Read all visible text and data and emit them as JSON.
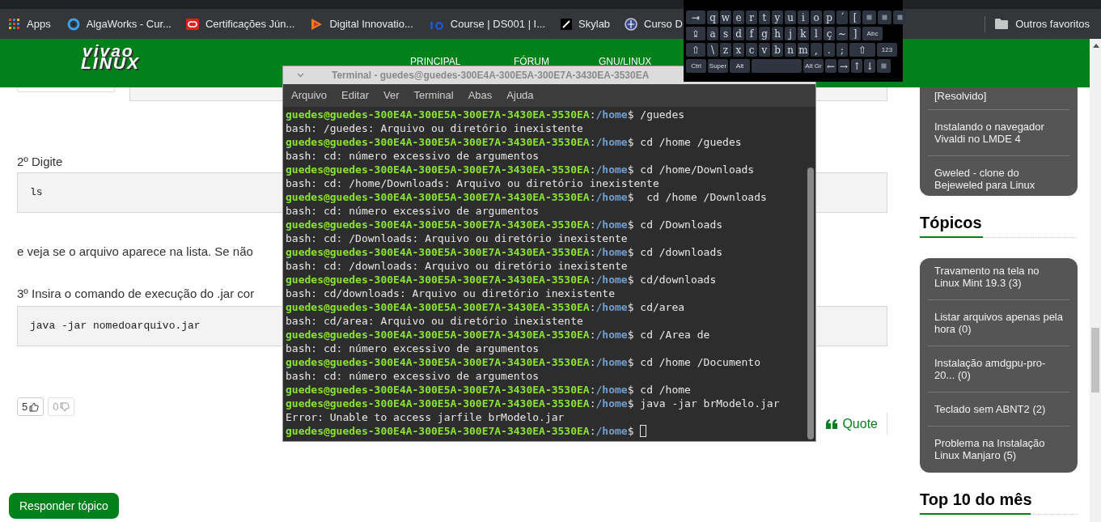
{
  "bookmarks_bar": {
    "items": [
      {
        "label": "Apps"
      },
      {
        "label": "AlgaWorks - Cur..."
      },
      {
        "label": "Certificações Jún..."
      },
      {
        "label": "Digital Innovatio..."
      },
      {
        "label": "Course | DS001 | I..."
      },
      {
        "label": "Skylab"
      },
      {
        "label": "Curso D"
      }
    ],
    "other": "Outros favoritos"
  },
  "site": {
    "logo": {
      "line1": "vivao",
      "line2": "LINUX"
    },
    "nav": [
      "PRINCIPAL",
      "FÓRUM",
      "GNU/LINUX"
    ],
    "content": [
      {
        "kind": "text",
        "text": "2º Digite"
      },
      {
        "kind": "code",
        "text": "ls"
      },
      {
        "kind": "text",
        "text": "e veja se o arquivo aparece na lista. Se não"
      },
      {
        "kind": "text",
        "text": "3º Insira o comando de execução do .jar cor"
      },
      {
        "kind": "code",
        "text": "java -jar nomedoarquivo.jar"
      }
    ],
    "votes": [
      {
        "count": "5",
        "kind": "up"
      },
      {
        "count": "0",
        "kind": "down"
      }
    ],
    "quote": "Quote",
    "reply_button": "Responder tópico",
    "sidebar": {
      "top_card": [
        "[Resolvido]",
        "Instalando o navegador Vivaldi no LMDE 4",
        "Gweled - clone do Bejeweled para Linux"
      ],
      "topics_heading": "Tópicos",
      "topics": [
        "Travamento na tela no Linux Mint 19.3 (3)",
        "Listar arquivos apenas pela hora (0)",
        "Instalação amdgpu-pro-20... (0)",
        "Teclado sem ABNT2 (2)",
        "Problema na Instalação Linux Manjaro (5)"
      ],
      "top10_heading": "Top 10 do mês"
    }
  },
  "terminal": {
    "title": "Terminal - guedes@guedes-300E4A-300E5A-300E7A-3430EA-3530EA",
    "menu": [
      "Arquivo",
      "Editar",
      "Ver",
      "Terminal",
      "Abas",
      "Ajuda"
    ],
    "cursor": true,
    "lines": [
      {
        "kind": "prompt",
        "user": "guedes@guedes-300E4A-300E5A-300E7A-3430EA-3530EA",
        "sep": ":",
        "path": "/home",
        "command": "$ /guedes"
      },
      {
        "kind": "output",
        "text": "bash: /guedes: Arquivo ou diretório inexistente"
      },
      {
        "kind": "prompt",
        "user": "guedes@guedes-300E4A-300E5A-300E7A-3430EA-3530EA",
        "sep": ":",
        "path": "/home",
        "command": "$ cd /home /guedes"
      },
      {
        "kind": "output",
        "text": "bash: cd: número excessivo de argumentos"
      },
      {
        "kind": "prompt",
        "user": "guedes@guedes-300E4A-300E5A-300E7A-3430EA-3530EA",
        "sep": ":",
        "path": "/home",
        "command": "$ cd /home/Downloads"
      },
      {
        "kind": "output",
        "text": "bash: cd: /home/Downloads: Arquivo ou diretório inexistente"
      },
      {
        "kind": "prompt",
        "user": "guedes@guedes-300E4A-300E5A-300E7A-3430EA-3530EA",
        "sep": ":",
        "path": "/home",
        "command": "$  cd /home /Downloads"
      },
      {
        "kind": "output",
        "text": "bash: cd: número excessivo de argumentos"
      },
      {
        "kind": "prompt",
        "user": "guedes@guedes-300E4A-300E5A-300E7A-3430EA-3530EA",
        "sep": ":",
        "path": "/home",
        "command": "$ cd /Downloads"
      },
      {
        "kind": "output",
        "text": "bash: cd: /Downloads: Arquivo ou diretório inexistente"
      },
      {
        "kind": "prompt",
        "user": "guedes@guedes-300E4A-300E5A-300E7A-3430EA-3530EA",
        "sep": ":",
        "path": "/home",
        "command": "$ cd /downloads"
      },
      {
        "kind": "output",
        "text": "bash: cd: /downloads: Arquivo ou diretório inexistente"
      },
      {
        "kind": "prompt",
        "user": "guedes@guedes-300E4A-300E5A-300E7A-3430EA-3530EA",
        "sep": ":",
        "path": "/home",
        "command": "$ cd/downloads"
      },
      {
        "kind": "output",
        "text": "bash: cd/downloads: Arquivo ou diretório inexistente"
      },
      {
        "kind": "prompt",
        "user": "guedes@guedes-300E4A-300E5A-300E7A-3430EA-3530EA",
        "sep": ":",
        "path": "/home",
        "command": "$ cd/area"
      },
      {
        "kind": "output",
        "text": "bash: cd/area: Arquivo ou diretório inexistente"
      },
      {
        "kind": "prompt",
        "user": "guedes@guedes-300E4A-300E5A-300E7A-3430EA-3530EA",
        "sep": ":",
        "path": "/home",
        "command": "$ cd /Area de"
      },
      {
        "kind": "output",
        "text": "bash: cd: número excessivo de argumentos"
      },
      {
        "kind": "prompt",
        "user": "guedes@guedes-300E4A-300E5A-300E7A-3430EA-3530EA",
        "sep": ":",
        "path": "/home",
        "command": "$ cd /home /Documento"
      },
      {
        "kind": "output",
        "text": "bash: cd: número excessivo de argumentos"
      },
      {
        "kind": "prompt",
        "user": "guedes@guedes-300E4A-300E5A-300E7A-3430EA-3530EA",
        "sep": ":",
        "path": "/home",
        "command": "$ cd /home"
      },
      {
        "kind": "prompt",
        "user": "guedes@guedes-300E4A-300E5A-300E7A-3430EA-3530EA",
        "sep": ":",
        "path": "/home",
        "command": "$ java -jar brModelo.jar"
      },
      {
        "kind": "output",
        "text": "Error: Unable to access jarfile brModelo.jar"
      },
      {
        "kind": "prompt",
        "user": "guedes@guedes-300E4A-300E5A-300E7A-3430EA-3530EA",
        "sep": ":",
        "path": "/home",
        "command": "$"
      }
    ]
  },
  "keyboard": {
    "rows": [
      {
        "keys": [
          {
            "kind": "mod",
            "label": "⇥"
          },
          {
            "kind": "char",
            "label": "q"
          },
          {
            "kind": "char",
            "label": "w"
          },
          {
            "kind": "char",
            "label": "e"
          },
          {
            "kind": "char",
            "label": "r"
          },
          {
            "kind": "char",
            "label": "t"
          },
          {
            "kind": "char",
            "label": "y"
          },
          {
            "kind": "char",
            "label": "u"
          },
          {
            "kind": "char",
            "label": "i"
          },
          {
            "kind": "char",
            "label": "o"
          },
          {
            "kind": "char",
            "label": "p"
          },
          {
            "kind": "char",
            "label": "´"
          },
          {
            "kind": "char",
            "label": "["
          },
          {
            "kind": "icon"
          },
          {
            "kind": "icon"
          },
          {
            "kind": "icon"
          }
        ]
      },
      {
        "keys": [
          {
            "kind": "mod",
            "label": "⇪"
          },
          {
            "kind": "char",
            "label": "a"
          },
          {
            "kind": "char",
            "label": "s"
          },
          {
            "kind": "char",
            "label": "d"
          },
          {
            "kind": "char",
            "label": "f"
          },
          {
            "kind": "char",
            "label": "g"
          },
          {
            "kind": "char",
            "label": "h"
          },
          {
            "kind": "char",
            "label": "j"
          },
          {
            "kind": "char",
            "label": "k"
          },
          {
            "kind": "char",
            "label": "l"
          },
          {
            "kind": "char",
            "label": "ç"
          },
          {
            "kind": "char",
            "label": "~"
          },
          {
            "kind": "char",
            "label": "]"
          },
          {
            "kind": "small",
            "label": "Abc"
          }
        ]
      },
      {
        "keys": [
          {
            "kind": "mod",
            "label": "⇧"
          },
          {
            "kind": "char",
            "label": "\\"
          },
          {
            "kind": "char",
            "label": "z"
          },
          {
            "kind": "char",
            "label": "x"
          },
          {
            "kind": "char",
            "label": "c"
          },
          {
            "kind": "char",
            "label": "v"
          },
          {
            "kind": "char",
            "label": "b"
          },
          {
            "kind": "char",
            "label": "n"
          },
          {
            "kind": "char",
            "label": "m"
          },
          {
            "kind": "char",
            "label": ","
          },
          {
            "kind": "char",
            "label": "."
          },
          {
            "kind": "char",
            "label": ";"
          },
          {
            "kind": "wide",
            "label": "⇧"
          },
          {
            "kind": "small",
            "label": "123"
          }
        ]
      },
      {
        "keys": [
          {
            "kind": "small",
            "label": "Ctrl"
          },
          {
            "kind": "small",
            "label": "Super"
          },
          {
            "kind": "small",
            "label": "Alt"
          },
          {
            "kind": "space"
          },
          {
            "kind": "small",
            "label": "Alt Gr"
          },
          {
            "kind": "char",
            "label": "←"
          },
          {
            "kind": "char",
            "label": "→"
          },
          {
            "kind": "char",
            "label": "↑"
          },
          {
            "kind": "char",
            "label": "↓"
          },
          {
            "kind": "icon"
          }
        ]
      }
    ]
  }
}
